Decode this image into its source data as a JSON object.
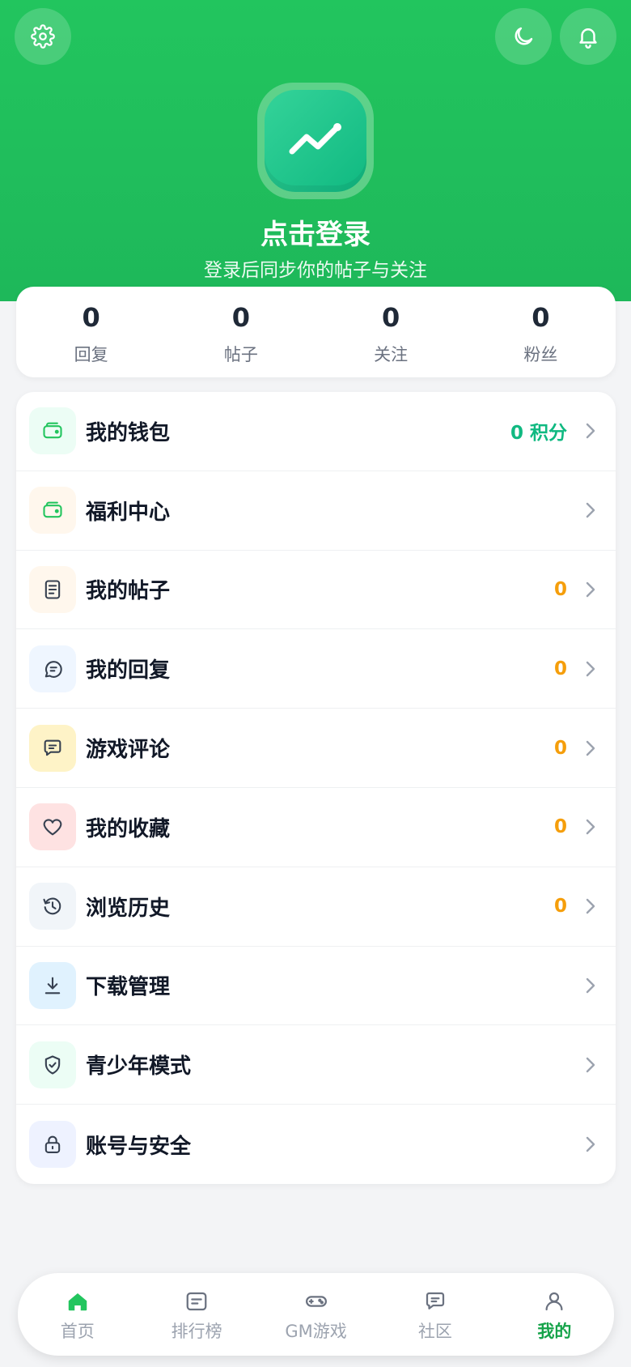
{
  "header": {
    "login_title": "点击登录",
    "login_subtitle": "登录后同步你的帖子与关注",
    "settings_icon": "gear-icon",
    "theme_icon": "moon-icon",
    "notification_icon": "bell-icon",
    "avatar_icon": "trend-line-icon",
    "accent_color": "#22c55e"
  },
  "stats": [
    {
      "value": "0",
      "label": "回复"
    },
    {
      "value": "0",
      "label": "帖子"
    },
    {
      "value": "0",
      "label": "关注"
    },
    {
      "value": "0",
      "label": "粉丝"
    }
  ],
  "menu": [
    {
      "label": "我的钱包",
      "value": "0 积分",
      "icon": "wallet-icon",
      "value_color": "#10b981"
    },
    {
      "label": "福利中心",
      "value": "",
      "icon": "gift-wallet-icon"
    },
    {
      "label": "我的帖子",
      "value": "0",
      "icon": "document-icon",
      "value_color": "#f59e0b"
    },
    {
      "label": "我的回复",
      "value": "0",
      "icon": "chat-reply-icon",
      "value_color": "#f59e0b"
    },
    {
      "label": "游戏评论",
      "value": "0",
      "icon": "comment-icon",
      "value_color": "#f59e0b"
    },
    {
      "label": "我的收藏",
      "value": "0",
      "icon": "heart-icon",
      "value_color": "#f59e0b"
    },
    {
      "label": "浏览历史",
      "value": "0",
      "icon": "history-icon",
      "value_color": "#f59e0b"
    },
    {
      "label": "下载管理",
      "value": "",
      "icon": "download-icon"
    },
    {
      "label": "青少年模式",
      "value": "",
      "icon": "shield-check-icon"
    },
    {
      "label": "账号与安全",
      "value": "",
      "icon": "lock-icon"
    }
  ],
  "tabbar": [
    {
      "label": "首页",
      "icon": "home-icon"
    },
    {
      "label": "排行榜",
      "icon": "ranking-icon"
    },
    {
      "label": "GM游戏",
      "icon": "gamepad-icon"
    },
    {
      "label": "社区",
      "icon": "community-icon"
    },
    {
      "label": "我的",
      "icon": "user-icon",
      "active": true
    }
  ]
}
